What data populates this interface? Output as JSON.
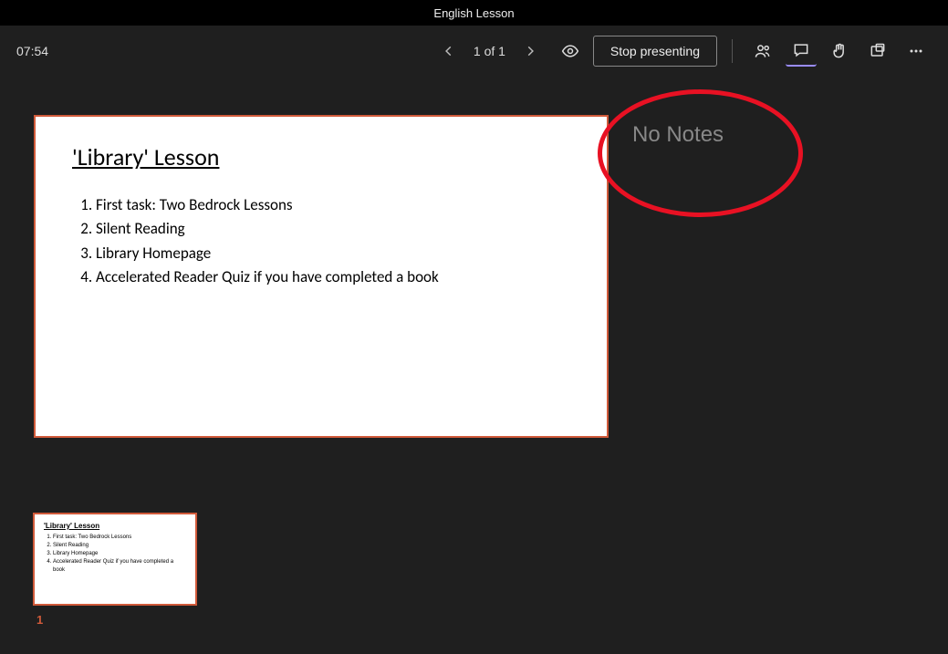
{
  "title": "English Lesson",
  "toolbar": {
    "time": "07:54",
    "page_indicator": "1 of 1",
    "stop_label": "Stop presenting"
  },
  "slide": {
    "title": "'Library' Lesson",
    "items": [
      "First task: Two Bedrock Lessons",
      "Silent Reading",
      "Library Homepage",
      "Accelerated Reader Quiz if you have completed a book"
    ]
  },
  "notes_text": "No Notes",
  "thumb": {
    "number": "1"
  }
}
